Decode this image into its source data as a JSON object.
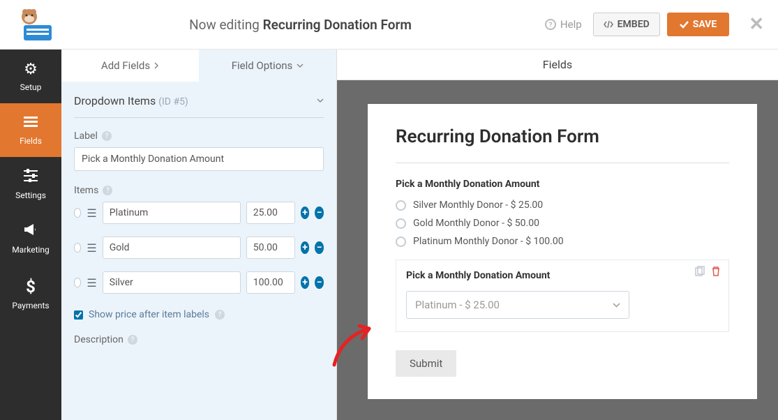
{
  "topbar": {
    "editing_prefix": "Now editing",
    "form_name": "Recurring Donation Form",
    "help": "Help",
    "embed": "EMBED",
    "save": "SAVE"
  },
  "sidenav": {
    "setup": "Setup",
    "fields": "Fields",
    "settings": "Settings",
    "marketing": "Marketing",
    "payments": "Payments"
  },
  "panel": {
    "title": "Fields",
    "tab_add": "Add Fields",
    "tab_opts": "Field Options",
    "section_name": "Dropdown Items",
    "section_id": "(ID #5)",
    "label_lbl": "Label",
    "label_val": "Pick a Monthly Donation Amount",
    "items_lbl": "Items",
    "items": [
      {
        "name": "Platinum",
        "price": "25.00"
      },
      {
        "name": "Gold",
        "price": "50.00"
      },
      {
        "name": "Silver",
        "price": "100.00"
      }
    ],
    "show_price": "Show price after item labels",
    "desc_lbl": "Description"
  },
  "preview": {
    "heading": "Recurring Donation Form",
    "field1_label": "Pick a Monthly Donation Amount",
    "opts": [
      "Silver Monthly Donor - $ 25.00",
      "Gold Monthly Donor - $ 50.00",
      "Platinum Monthly Donor - $ 100.00"
    ],
    "field2_label": "Pick a Monthly Donation Amount",
    "dropdown_val": "Platinum - $ 25.00",
    "submit": "Submit"
  }
}
